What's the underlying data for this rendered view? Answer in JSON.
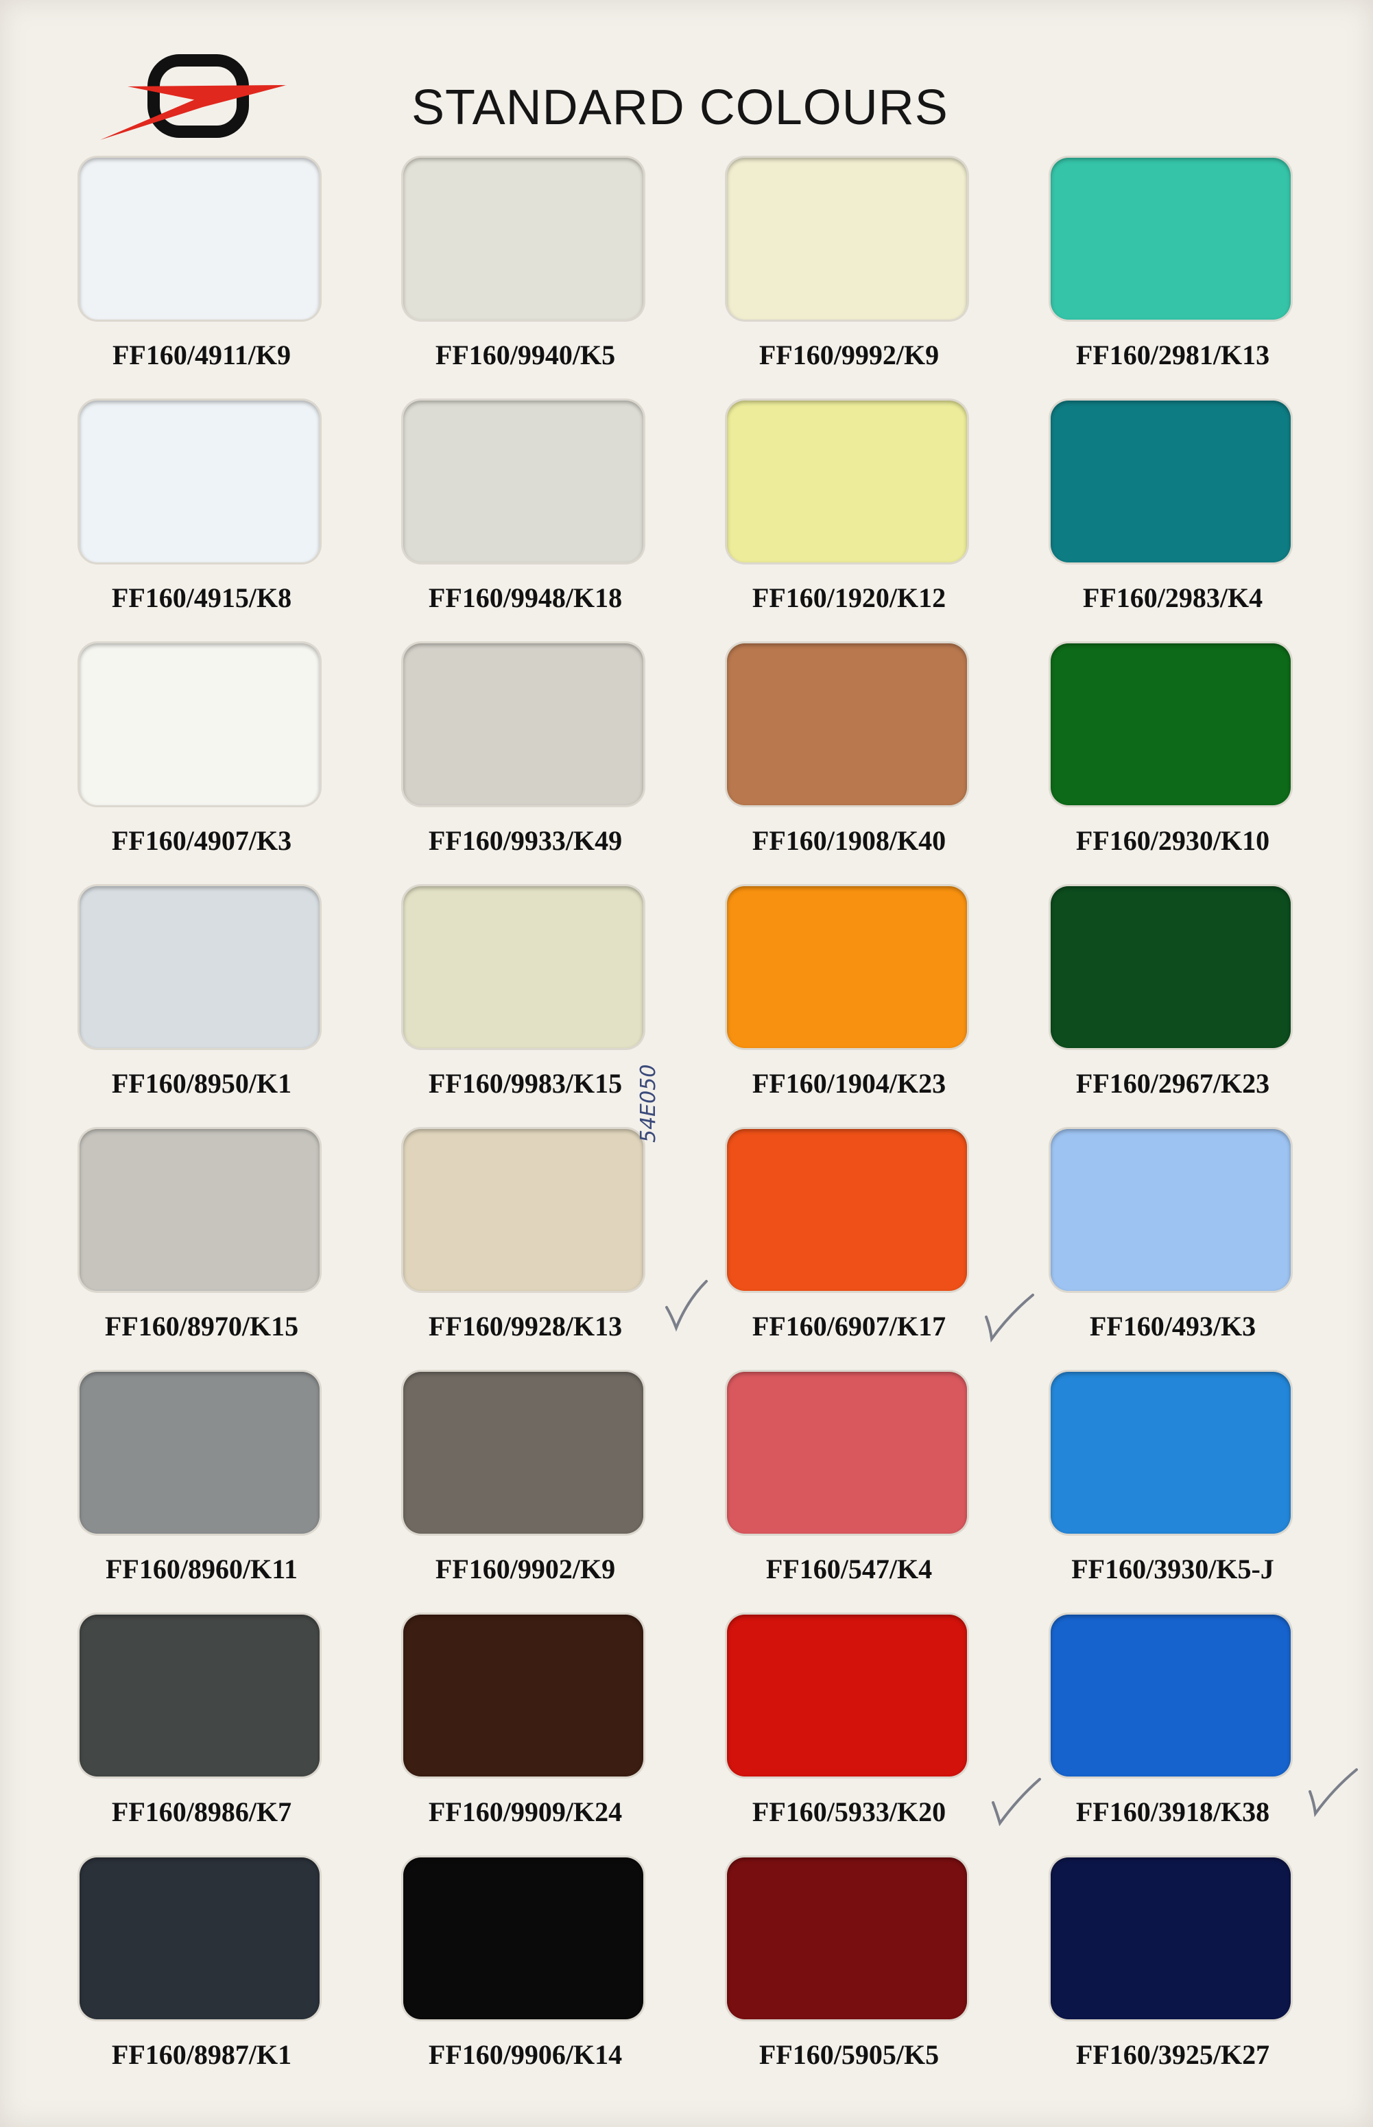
{
  "header": {
    "title": "STANDARD COLOURS",
    "brand_colors": {
      "ring": "#111111",
      "swoosh": "#e0281e"
    }
  },
  "swatches": [
    {
      "code": "FF160/4911/K9",
      "color": "#f0f3f6"
    },
    {
      "code": "FF160/9940/K5",
      "color": "#e2e1d7"
    },
    {
      "code": "FF160/9992/K9",
      "color": "#f1eed0"
    },
    {
      "code": "FF160/2981/K13",
      "color": "#35c4a8"
    },
    {
      "code": "FF160/4915/K8",
      "color": "#eef3f7"
    },
    {
      "code": "FF160/9948/K18",
      "color": "#dcdcd4"
    },
    {
      "code": "FF160/1920/K12",
      "color": "#ecec9a"
    },
    {
      "code": "FF160/2983/K4",
      "color": "#0e7c83"
    },
    {
      "code": "FF160/4907/K3",
      "color": "#f6f6f1"
    },
    {
      "code": "FF160/9933/K49",
      "color": "#d4d1c9"
    },
    {
      "code": "FF160/1908/K40",
      "color": "#b9784e"
    },
    {
      "code": "FF160/2930/K10",
      "color": "#0d6a18"
    },
    {
      "code": "FF160/8950/K1",
      "color": "#d7dde1"
    },
    {
      "code": "FF160/9983/K15",
      "color": "#e2e1c5"
    },
    {
      "code": "FF160/1904/K23",
      "color": "#f8910f"
    },
    {
      "code": "FF160/2967/K23",
      "color": "#0c4c1d"
    },
    {
      "code": "FF160/8970/K15",
      "color": "#c6c4bd"
    },
    {
      "code": "FF160/9928/K13",
      "color": "#e0d5bc"
    },
    {
      "code": "FF160/6907/K17",
      "color": "#ee5017"
    },
    {
      "code": "FF160/493/K3",
      "color": "#9dc3f2"
    },
    {
      "code": "FF160/8960/K11",
      "color": "#8b8e8f"
    },
    {
      "code": "FF160/9902/K9",
      "color": "#6f6961"
    },
    {
      "code": "FF160/547/K4",
      "color": "#d9585e"
    },
    {
      "code": "FF160/3930/K5-J",
      "color": "#2386d8"
    },
    {
      "code": "FF160/8986/K7",
      "color": "#434745"
    },
    {
      "code": "FF160/9909/K24",
      "color": "#3b1d11"
    },
    {
      "code": "FF160/5933/K20",
      "color": "#d2120b"
    },
    {
      "code": "FF160/3918/K38",
      "color": "#1663cd"
    },
    {
      "code": "FF160/8987/K1",
      "color": "#2b3139"
    },
    {
      "code": "FF160/9906/K14",
      "color": "#0b0a0b"
    },
    {
      "code": "FF160/5905/K5",
      "color": "#780e10"
    },
    {
      "code": "FF160/3925/K27",
      "color": "#0c1548"
    }
  ],
  "annotations": {
    "handwritten_note": "54E050"
  }
}
